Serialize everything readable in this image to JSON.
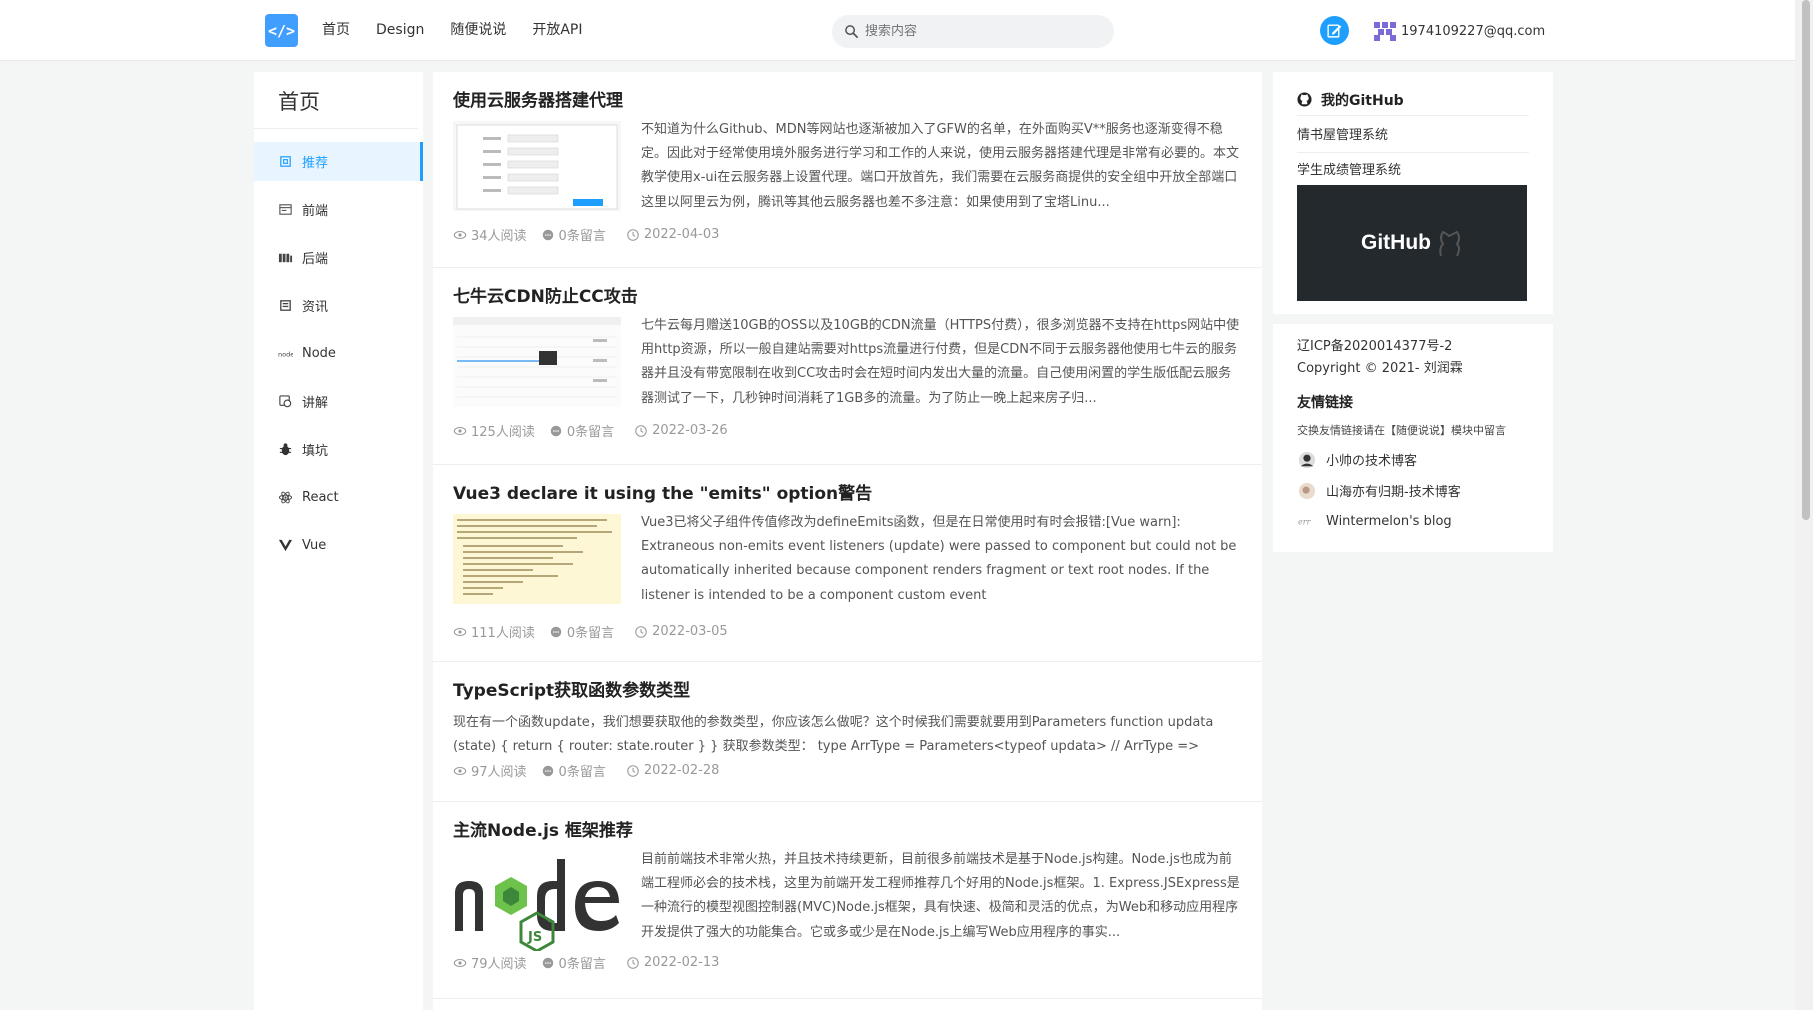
{
  "header": {
    "logo_glyph": "</>",
    "nav": [
      "首页",
      "Design",
      "随便说说",
      "开放API"
    ],
    "search_placeholder": "搜索内容",
    "user_email": "1974109227@qq.com"
  },
  "sidebar": {
    "title": "首页",
    "items": [
      {
        "label": "推荐",
        "icon": "recommend-icon",
        "active": true
      },
      {
        "label": "前端",
        "icon": "frontend-icon"
      },
      {
        "label": "后端",
        "icon": "backend-icon"
      },
      {
        "label": "资讯",
        "icon": "news-icon"
      },
      {
        "label": "Node",
        "icon": "node-icon"
      },
      {
        "label": "讲解",
        "icon": "explain-icon"
      },
      {
        "label": "填坑",
        "icon": "bug-icon"
      },
      {
        "label": "React",
        "icon": "react-icon"
      },
      {
        "label": "Vue",
        "icon": "vue-icon"
      }
    ]
  },
  "articles": [
    {
      "title": "使用云服务器搭建代理",
      "desc": "不知道为什么Github、MDN等网站也逐渐被加入了GFW的名单，在外面购买V**服务也逐渐变得不稳定。因此对于经常使用境外服务进行学习和工作的人来说，使用云服务器搭建代理是非常有必要的。本文教学使用x-ui在云服务器上设置代理。端口开放首先，我们需要在云服务商提供的安全组中开放全部端口这里以阿里云为例，腾讯等其他云服务器也差不多注意：如果使用到了宝塔Linu...",
      "reads": "34人阅读",
      "comments": "0条留言",
      "date": "2022-04-03"
    },
    {
      "title": "七牛云CDN防止CC攻击",
      "desc": "七牛云每月赠送10GB的OSS以及10GB的CDN流量（HTTPS付费），很多浏览器不支持在https网站中使用http资源，所以一般自建站需要对https流量进行付费，但是CDN不同于云服务器他使用七牛云的服务器并且没有带宽限制在收到CC攻击时会在短时间内发出大量的流量。自己使用闲置的学生版低配云服务器测试了一下，几秒钟时间消耗了1GB多的流量。为了防止一晚上起来房子归...",
      "reads": "125人阅读",
      "comments": "0条留言",
      "date": "2022-03-26"
    },
    {
      "title": "Vue3 declare it using the \"emits\" option警告",
      "desc": "Vue3已将父子组件传值修改为defineEmits函数，但是在日常使用时有时会报错:[Vue warn]: Extraneous non-emits event listeners (update) were passed to component but could not be automatically inherited because component renders fragment or text root nodes. If the listener is intended to be a component custom event",
      "reads": "111人阅读",
      "comments": "0条留言",
      "date": "2022-03-05"
    },
    {
      "title": "TypeScript获取函数参数类型",
      "desc": "现在有一个函数update，我们想要获取他的参数类型，你应该怎么做呢？这个时候我们需要就要用到Parameters function updata (state) { return { router: state.router } } 获取参数类型： type ArrType = Parameters<typeof updata> // ArrType => [state: any] ...",
      "reads": "97人阅读",
      "comments": "0条留言",
      "date": "2022-02-28"
    },
    {
      "title": "主流Node.js 框架推荐",
      "desc": "目前前端技术非常火热，并且技术持续更新，目前很多前端技术是基于Node.js构建。Node.js也成为前端工程师必会的技术栈，这里为前端开发工程师推荐几个好用的Node.js框架。1. Express.JSExpress是一种流行的模型视图控制器(MVC)Node.js框架，具有快速、极简和灵活的优点，为Web和移动应用程序开发提供了强大的功能集合。它或多或少是在Node.js上编写Web应用程序的事实...",
      "reads": "79人阅读",
      "comments": "0条留言",
      "date": "2022-02-13"
    }
  ],
  "github": {
    "title": "我的GitHub",
    "links": [
      "情书屋管理系统",
      "学生成绩管理系统"
    ],
    "banner_text": "GitHub"
  },
  "footer": {
    "icp": "辽ICP备2020014377号-2",
    "copyright": "Copyright © 2021- 刘润霖",
    "friends_title": "友情链接",
    "friends_tip": "交换友情链接请在【随便说说】模块中留言",
    "friends": [
      "小帅の技术博客",
      "山海亦有归期-技术博客",
      "Wintermelon's blog"
    ]
  },
  "colors": {
    "accent": "#1e9fff",
    "github_banner": "#24292e"
  }
}
